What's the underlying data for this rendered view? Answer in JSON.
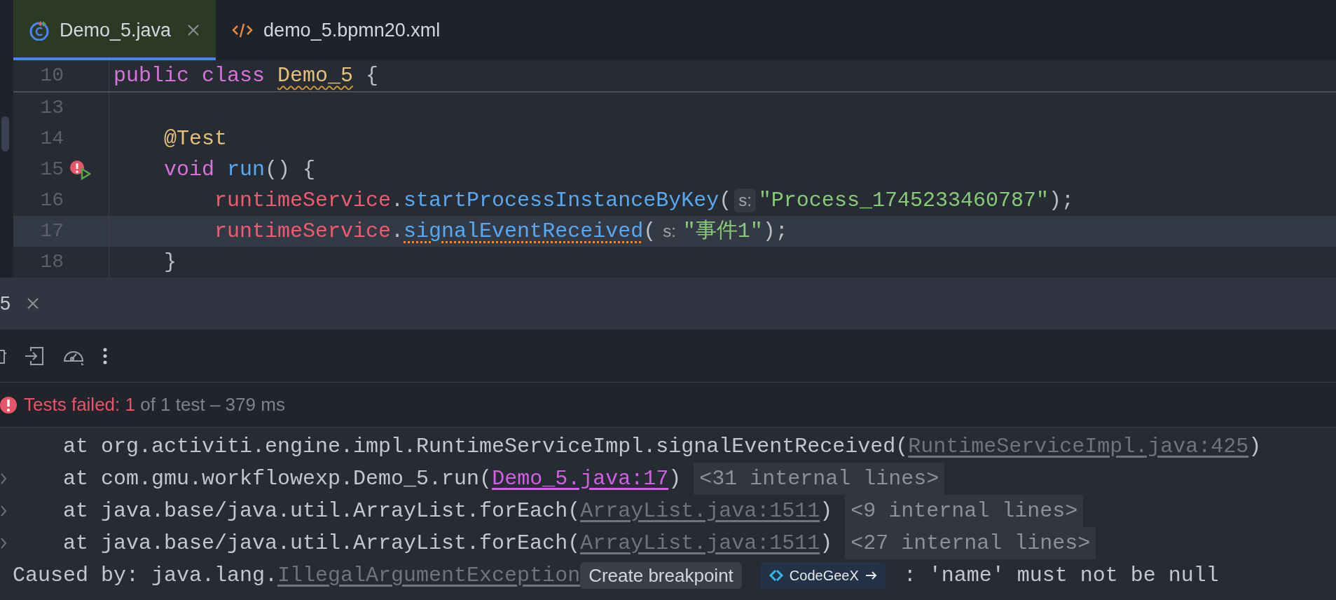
{
  "tabs": [
    {
      "label": "Demo_5.java",
      "kind": "java",
      "selected": true,
      "closable": true
    },
    {
      "label": "demo_5.bpmn20.xml",
      "kind": "xml",
      "selected": false,
      "closable": false
    }
  ],
  "editor": {
    "sticky_line": {
      "number": "10",
      "tokens": [
        {
          "text": "public ",
          "kind": "keyword"
        },
        {
          "text": "class ",
          "kind": "keyword"
        },
        {
          "text": "Demo_5",
          "kind": "class",
          "warning": true
        },
        {
          "text": " {",
          "kind": "plain"
        }
      ]
    },
    "lines": [
      {
        "number": "13",
        "current": false
      },
      {
        "number": "14",
        "current": false,
        "tokens": [
          {
            "text": "    @Test",
            "kind": "annotation"
          }
        ]
      },
      {
        "number": "15",
        "current": false,
        "error": true,
        "runnable": true,
        "tokens": [
          {
            "text": "    void ",
            "kind": "keyword"
          },
          {
            "text": "run",
            "kind": "method"
          },
          {
            "text": "() {",
            "kind": "plain"
          }
        ]
      },
      {
        "number": "16",
        "current": false,
        "tokens": [
          {
            "text": "        runtimeService",
            "kind": "field"
          },
          {
            "text": ".",
            "kind": "plain"
          },
          {
            "text": "startProcessInstanceByKey",
            "kind": "method"
          },
          {
            "text": "(",
            "kind": "plain"
          },
          {
            "text": "s:",
            "kind": "hint"
          },
          {
            "text": "\"Process_1745233460787\"",
            "kind": "string"
          },
          {
            "text": ");",
            "kind": "plain"
          }
        ]
      },
      {
        "number": "17",
        "current": true,
        "tokens": [
          {
            "text": "        runtimeService",
            "kind": "field"
          },
          {
            "text": ".",
            "kind": "plain"
          },
          {
            "text": "signalEventReceived",
            "kind": "method",
            "warning": true
          },
          {
            "text": "(",
            "kind": "plain"
          },
          {
            "text": "s:",
            "kind": "hint"
          },
          {
            "text": "\"事件1\"",
            "kind": "string"
          },
          {
            "text": ");",
            "kind": "plain"
          }
        ]
      },
      {
        "number": "18",
        "current": false,
        "tokens": [
          {
            "text": "    }",
            "kind": "plain"
          }
        ]
      }
    ]
  },
  "run_panel": {
    "tab": {
      "label": "5",
      "closable": true
    },
    "status": {
      "failed": "Tests failed: 1",
      "rest": " of 1 test – 379 ms"
    },
    "console": [
      {
        "expandable": false,
        "tokens": [
          {
            "text": "    at org.activiti.engine.impl.RuntimeServiceImpl.signalEventReceived(",
            "kind": "plain"
          },
          {
            "text": "RuntimeServiceImpl.java:425",
            "kind": "library_link"
          },
          {
            "text": ")",
            "kind": "plain"
          }
        ]
      },
      {
        "expandable": true,
        "tokens": [
          {
            "text": "    at com.gmu.workflowexp.Demo_5.run(",
            "kind": "plain"
          },
          {
            "text": "Demo_5.java:17",
            "kind": "source_link"
          },
          {
            "text": ")",
            "kind": "plain"
          },
          {
            "text": "<31 internal lines>",
            "kind": "folded"
          }
        ]
      },
      {
        "expandable": true,
        "tokens": [
          {
            "text": "    at java.base/java.util.ArrayList.forEach(",
            "kind": "plain"
          },
          {
            "text": "ArrayList.java:1511",
            "kind": "library_link"
          },
          {
            "text": ")",
            "kind": "plain"
          },
          {
            "text": "<9 internal lines>",
            "kind": "folded"
          }
        ]
      },
      {
        "expandable": true,
        "tokens": [
          {
            "text": "    at java.base/java.util.ArrayList.forEach(",
            "kind": "plain"
          },
          {
            "text": "ArrayList.java:1511",
            "kind": "library_link"
          },
          {
            "text": ")",
            "kind": "plain"
          },
          {
            "text": "<27 internal lines>",
            "kind": "folded"
          }
        ]
      },
      {
        "expandable": false,
        "tokens": [
          {
            "text": "Caused by: java.lang.",
            "kind": "plain"
          },
          {
            "text": "IllegalArgumentException",
            "kind": "library_link"
          },
          {
            "text": "Create breakpoint",
            "kind": "breakpoint_chip"
          },
          {
            "text": "CodeGeeX",
            "kind": "ai_chip"
          },
          {
            "text": ": 'name' must not be null",
            "kind": "plain"
          }
        ]
      }
    ]
  }
}
